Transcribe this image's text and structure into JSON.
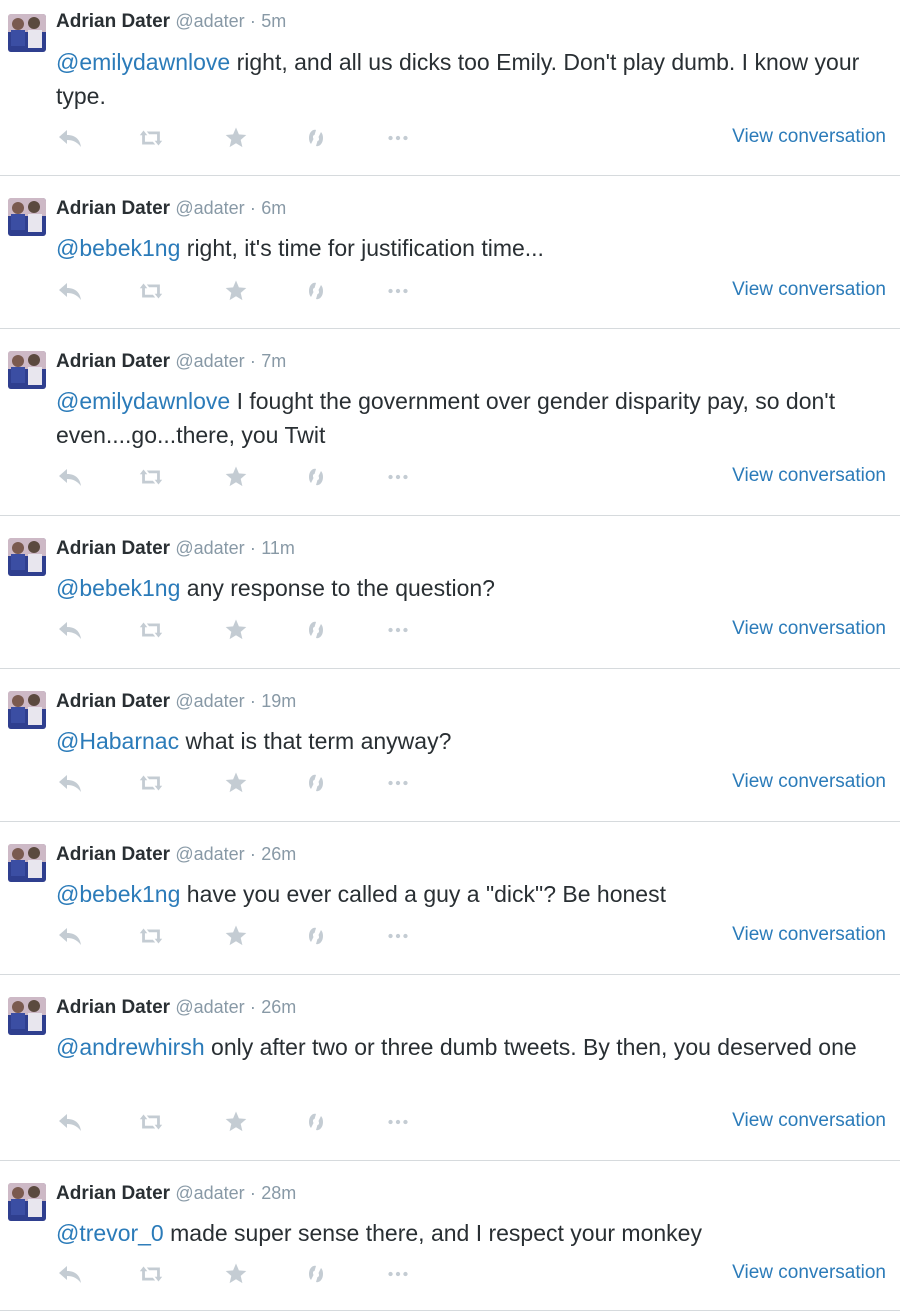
{
  "tweets": [
    {
      "name": "Adrian Dater",
      "handle": "@adater",
      "sep": "·",
      "time": "5m",
      "mention": "@emilydawnlove",
      "text": " right, and all us dicks too Emily. Don't play dumb. I know your type.",
      "link": "View conversation"
    },
    {
      "name": "Adrian Dater",
      "handle": "@adater",
      "sep": "·",
      "time": "6m",
      "mention": "@bebek1ng",
      "text": " right, it's time for justification time...",
      "link": "View conversation"
    },
    {
      "name": "Adrian Dater",
      "handle": "@adater",
      "sep": "·",
      "time": "7m",
      "mention": "@emilydawnlove",
      "text": " I fought the government over gender disparity pay, so don't even....go...there, you Twit",
      "link": "View conversation"
    },
    {
      "name": "Adrian Dater",
      "handle": "@adater",
      "sep": "·",
      "time": "11m",
      "mention": "@bebek1ng",
      "text": " any response to the question?",
      "link": "View conversation"
    },
    {
      "name": "Adrian Dater",
      "handle": "@adater",
      "sep": "·",
      "time": "19m",
      "mention": "@Habarnac",
      "text": " what is that term anyway?",
      "link": "View conversation"
    },
    {
      "name": "Adrian Dater",
      "handle": "@adater",
      "sep": "·",
      "time": "26m",
      "mention": "@bebek1ng",
      "text": " have you ever called a guy a \"dick\"? Be honest",
      "link": "View conversation"
    },
    {
      "name": "Adrian Dater",
      "handle": "@adater",
      "sep": "·",
      "time": "26m",
      "mention": "@andrewhirsh",
      "text": " only after two or three dumb tweets. By then, you deserved one",
      "link": "View conversation"
    },
    {
      "name": "Adrian Dater",
      "handle": "@adater",
      "sep": "·",
      "time": "28m",
      "mention": "@trevor_0",
      "text": " made super sense there, and I respect your monkey",
      "link": "View conversation"
    }
  ],
  "icons": {
    "reply": "reply-icon",
    "retweet": "retweet-icon",
    "favorite": "star-icon",
    "tip": "tip-icon",
    "more": "more-icon",
    "avatar": "avatar-image"
  },
  "colors": {
    "link": "#2b7bb9",
    "text": "#292f33",
    "meta": "#8899a6",
    "icon": "#c4ccd3",
    "divider": "#d6dadd"
  }
}
